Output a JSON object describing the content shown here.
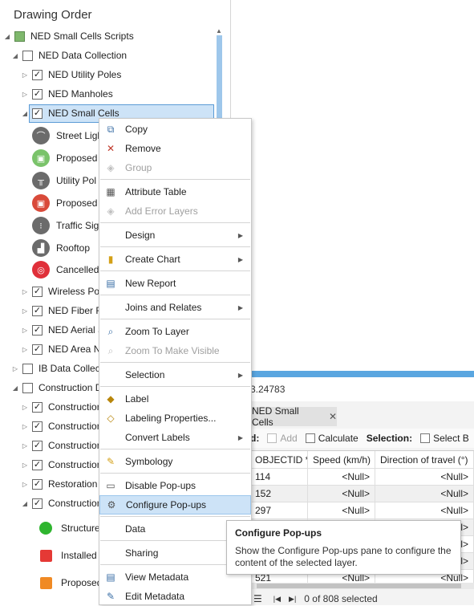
{
  "contents_pane": {
    "heading": "Drawing Order",
    "tree": [
      {
        "label": "NED Small Cells Scripts",
        "checked": true,
        "expanded": true
      },
      {
        "label": "NED Data Collection",
        "checked": false,
        "expanded": true
      },
      {
        "label": "NED Utility Poles",
        "checked": true,
        "expanded": false
      },
      {
        "label": "NED Manholes",
        "checked": true,
        "expanded": false
      },
      {
        "label": "NED Small Cells",
        "checked": true,
        "expanded": true,
        "selected": true
      },
      {
        "label": "Street Ligh",
        "symbol": "street-light"
      },
      {
        "label": "Proposed",
        "symbol": "proposed-green"
      },
      {
        "label": "Utility Pol",
        "symbol": "utility-pole"
      },
      {
        "label": "Proposed",
        "symbol": "proposed-red"
      },
      {
        "label": "Traffic Sig",
        "symbol": "traffic-signal"
      },
      {
        "label": "Rooftop",
        "symbol": "rooftop"
      },
      {
        "label": "Cancelled,",
        "symbol": "cancelled-target"
      },
      {
        "label": "Wireless Pow",
        "checked": true,
        "expanded": false
      },
      {
        "label": "NED Fiber Ro",
        "checked": true,
        "expanded": false
      },
      {
        "label": "NED Aerial S",
        "checked": true,
        "expanded": false
      },
      {
        "label": "NED Area No",
        "checked": true,
        "expanded": false
      },
      {
        "label": "IB Data Collect",
        "checked": false,
        "expanded": false
      },
      {
        "label": "Construction D",
        "checked": false,
        "expanded": true
      },
      {
        "label": "Construction",
        "checked": true,
        "expanded": false
      },
      {
        "label": "Construction",
        "checked": true,
        "expanded": false
      },
      {
        "label": "Construction",
        "checked": true,
        "expanded": false
      },
      {
        "label": "Construction",
        "checked": true,
        "expanded": false
      },
      {
        "label": "Restoration",
        "checked": true,
        "expanded": false
      },
      {
        "label": "Construction",
        "checked": true,
        "expanded": true
      },
      {
        "label": "Structure",
        "symbol": "green-pin"
      },
      {
        "label": "Installed",
        "symbol": "red-square"
      },
      {
        "label": "Proposed",
        "symbol": "orange-square"
      }
    ]
  },
  "map": {
    "coordinate_readout": "3.24783"
  },
  "table": {
    "tab_label": "NED Small Cells",
    "toolbar": {
      "field_label": "d:",
      "add_label": "Add",
      "calculate_label": "Calculate",
      "selection_label": "Selection:",
      "select_by_label": "Select B"
    },
    "columns": [
      "OBJECTID *",
      "Speed (km/h)",
      "Direction of travel (°)"
    ],
    "rows": [
      [
        "114",
        "<Null>",
        "<Null>"
      ],
      [
        "152",
        "<Null>",
        "<Null>"
      ],
      [
        "297",
        "<Null>",
        "<Null>"
      ],
      [
        "",
        "<Null>",
        "<Null>"
      ],
      [
        "",
        "<Null>",
        "<Null>"
      ],
      [
        "",
        "<Null>",
        "<Null>"
      ],
      [
        "521",
        "<Null>",
        "<Null>"
      ]
    ],
    "status": "0 of 808 selected"
  },
  "context_menu": {
    "items": [
      {
        "label": "Copy",
        "icon": "copy-icon"
      },
      {
        "label": "Remove",
        "icon": "remove-icon"
      },
      {
        "label": "Group",
        "icon": "group-icon",
        "disabled": true
      },
      {
        "label": "Attribute Table",
        "icon": "table-icon"
      },
      {
        "label": "Add Error Layers",
        "icon": "error-layers-icon",
        "disabled": true
      },
      {
        "label": "Design",
        "submenu": true
      },
      {
        "label": "Create Chart",
        "icon": "chart-icon",
        "submenu": true
      },
      {
        "label": "New Report",
        "icon": "report-icon"
      },
      {
        "label": "Joins and Relates",
        "submenu": true
      },
      {
        "label": "Zoom To Layer",
        "icon": "zoom-icon"
      },
      {
        "label": "Zoom To Make Visible",
        "icon": "zoom-visible-icon",
        "disabled": true
      },
      {
        "label": "Selection",
        "submenu": true
      },
      {
        "label": "Label",
        "icon": "label-icon"
      },
      {
        "label": "Labeling Properties...",
        "icon": "labeling-properties-icon"
      },
      {
        "label": "Convert Labels",
        "submenu": true
      },
      {
        "label": "Symbology",
        "icon": "symbology-icon"
      },
      {
        "label": "Disable Pop-ups",
        "icon": "disable-popups-icon"
      },
      {
        "label": "Configure Pop-ups",
        "icon": "configure-popups-icon",
        "hover": true
      },
      {
        "label": "Data",
        "submenu": true
      },
      {
        "label": "Sharing",
        "submenu": true
      },
      {
        "label": "View Metadata",
        "icon": "view-metadata-icon"
      },
      {
        "label": "Edit Metadata",
        "icon": "edit-metadata-icon"
      }
    ]
  },
  "tooltip": {
    "title": "Configure Pop-ups",
    "body": "Show the Configure Pop-ups pane to configure the content of the selected layer."
  },
  "colors": {
    "accent": "#5aa6e0",
    "selection": "#cde3f7",
    "selection_border": "#5b9bd5"
  }
}
